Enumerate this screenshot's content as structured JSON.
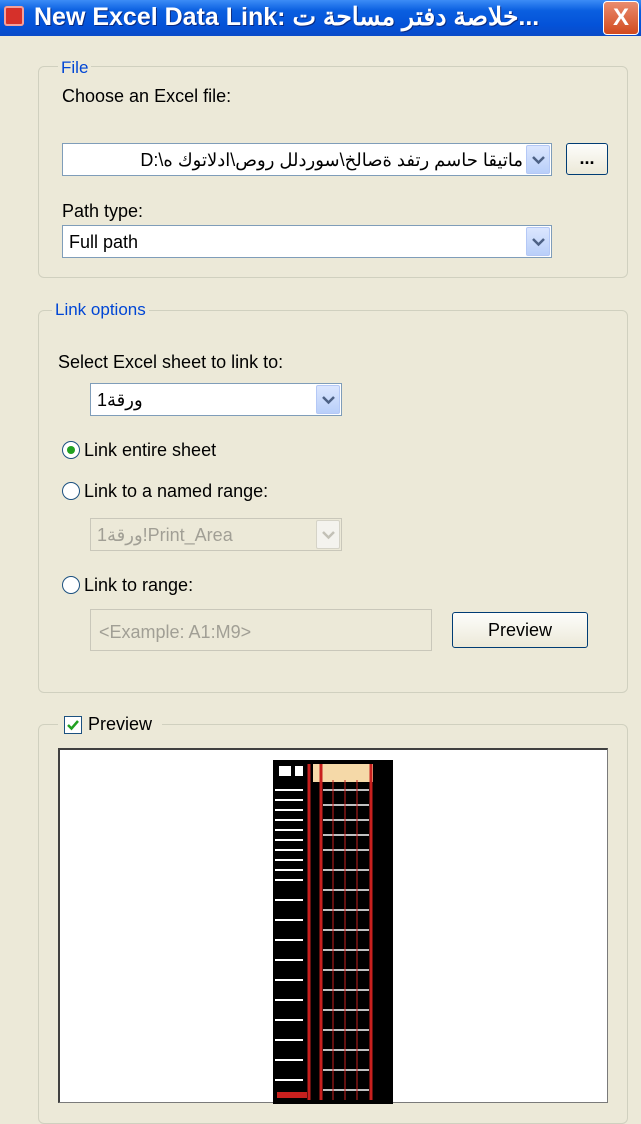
{
  "window": {
    "title": "New Excel Data Link: خلاصة دفتر مساحة ت...",
    "close_glyph": "X"
  },
  "file_group": {
    "legend": "File",
    "choose_label": "Choose an Excel file:",
    "file_value": "D:\\ماتيقا حاسم رتفد ةصالخ\\سوردلل روص\\ادلاتوك ه",
    "browse_label": "...",
    "path_type_label": "Path type:",
    "path_type_value": "Full path"
  },
  "link_options": {
    "legend": "Link options",
    "select_sheet_label": "Select Excel sheet to link to:",
    "sheet_value": "ورقة1",
    "link_entire_sheet_label": "Link entire sheet",
    "link_named_range_label": "Link to a named range:",
    "named_range_value": "ورقة1!Print_Area",
    "link_range_label": "Link to range:",
    "range_placeholder": "<Example: A1:M9>",
    "preview_button_label": "Preview",
    "selected_option": "link_entire_sheet"
  },
  "preview": {
    "checkbox_label": "Preview",
    "checked": true
  },
  "colors": {
    "title_blue": "#0452d8",
    "legend_blue": "#0046d5",
    "dialog_bg": "#ece9d8",
    "radio_green": "#21a121",
    "sheet_red": "#c8201e"
  }
}
